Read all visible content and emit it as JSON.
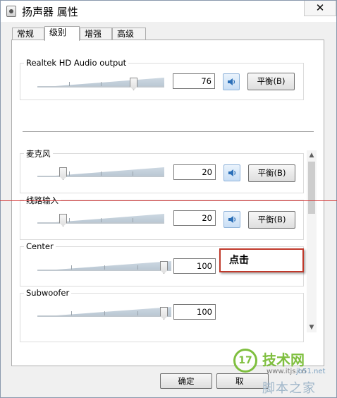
{
  "window": {
    "title": "扬声器 属性",
    "close_glyph": "✕"
  },
  "tabs": [
    {
      "label": "常规",
      "active": false
    },
    {
      "label": "级别",
      "active": true
    },
    {
      "label": "增强",
      "active": false
    },
    {
      "label": "高级",
      "active": false
    }
  ],
  "master": {
    "label": "Realtek HD Audio output",
    "value": "76",
    "level": 0.76,
    "mute_icon": "speaker-icon",
    "balance_label": "平衡(B)"
  },
  "channels": [
    {
      "label": "麦克风",
      "value": "20",
      "level": 0.2,
      "balance_label": "平衡(B)"
    },
    {
      "label": "线路输入",
      "value": "20",
      "level": 0.2,
      "balance_label": "平衡(B)"
    },
    {
      "label": "Center",
      "value": "100",
      "level": 1.0
    },
    {
      "label": "Subwoofer",
      "value": "100",
      "level": 1.0
    }
  ],
  "annotation": {
    "callout_text": "点击",
    "accent_color": "#c0392b"
  },
  "footer": {
    "ok_label": "确定",
    "cancel_label": "取"
  },
  "watermark": {
    "badge": "17",
    "brand": "技术网",
    "url_left": "www.itjs.cn",
    "url_right": "jb51.net",
    "site_cn": "脚本之家"
  }
}
